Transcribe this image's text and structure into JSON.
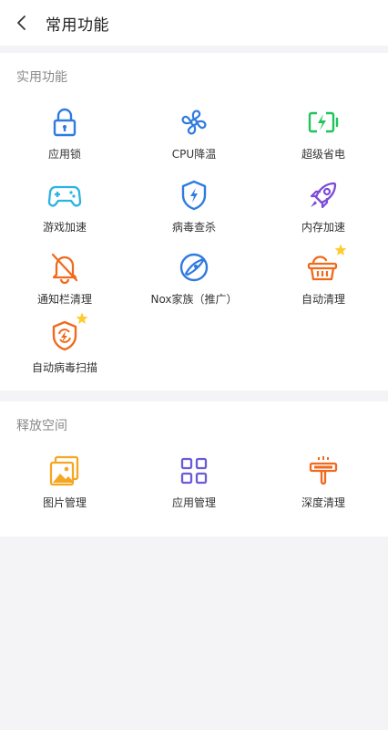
{
  "header": {
    "title": "常用功能"
  },
  "sections": [
    {
      "title": "实用功能",
      "items": [
        {
          "label": "应用锁",
          "icon": "lock-icon"
        },
        {
          "label": "CPU降温",
          "icon": "fan-icon"
        },
        {
          "label": "超级省电",
          "icon": "battery-charging-icon"
        },
        {
          "label": "游戏加速",
          "icon": "gamepad-icon"
        },
        {
          "label": "病毒查杀",
          "icon": "shield-bolt-icon"
        },
        {
          "label": "内存加速",
          "icon": "rocket-icon"
        },
        {
          "label": "通知栏清理",
          "icon": "bell-off-icon"
        },
        {
          "label": "Nox家族（推广）",
          "icon": "nox-logo-icon"
        },
        {
          "label": "自动清理",
          "icon": "basket-icon"
        },
        {
          "label": "自动病毒扫描",
          "icon": "shield-refresh-icon"
        }
      ]
    },
    {
      "title": "释放空间",
      "items": [
        {
          "label": "图片管理",
          "icon": "image-icon"
        },
        {
          "label": "应用管理",
          "icon": "apps-grid-icon"
        },
        {
          "label": "深度清理",
          "icon": "broom-icon"
        }
      ]
    }
  ],
  "colors": {
    "blue": "#2f7be0",
    "green": "#1fc45a",
    "cyan": "#2bb3e3",
    "purple": "#7b4bd8",
    "orange": "#f06a1e",
    "amber": "#f5a623",
    "star": "#ffcb2e"
  }
}
